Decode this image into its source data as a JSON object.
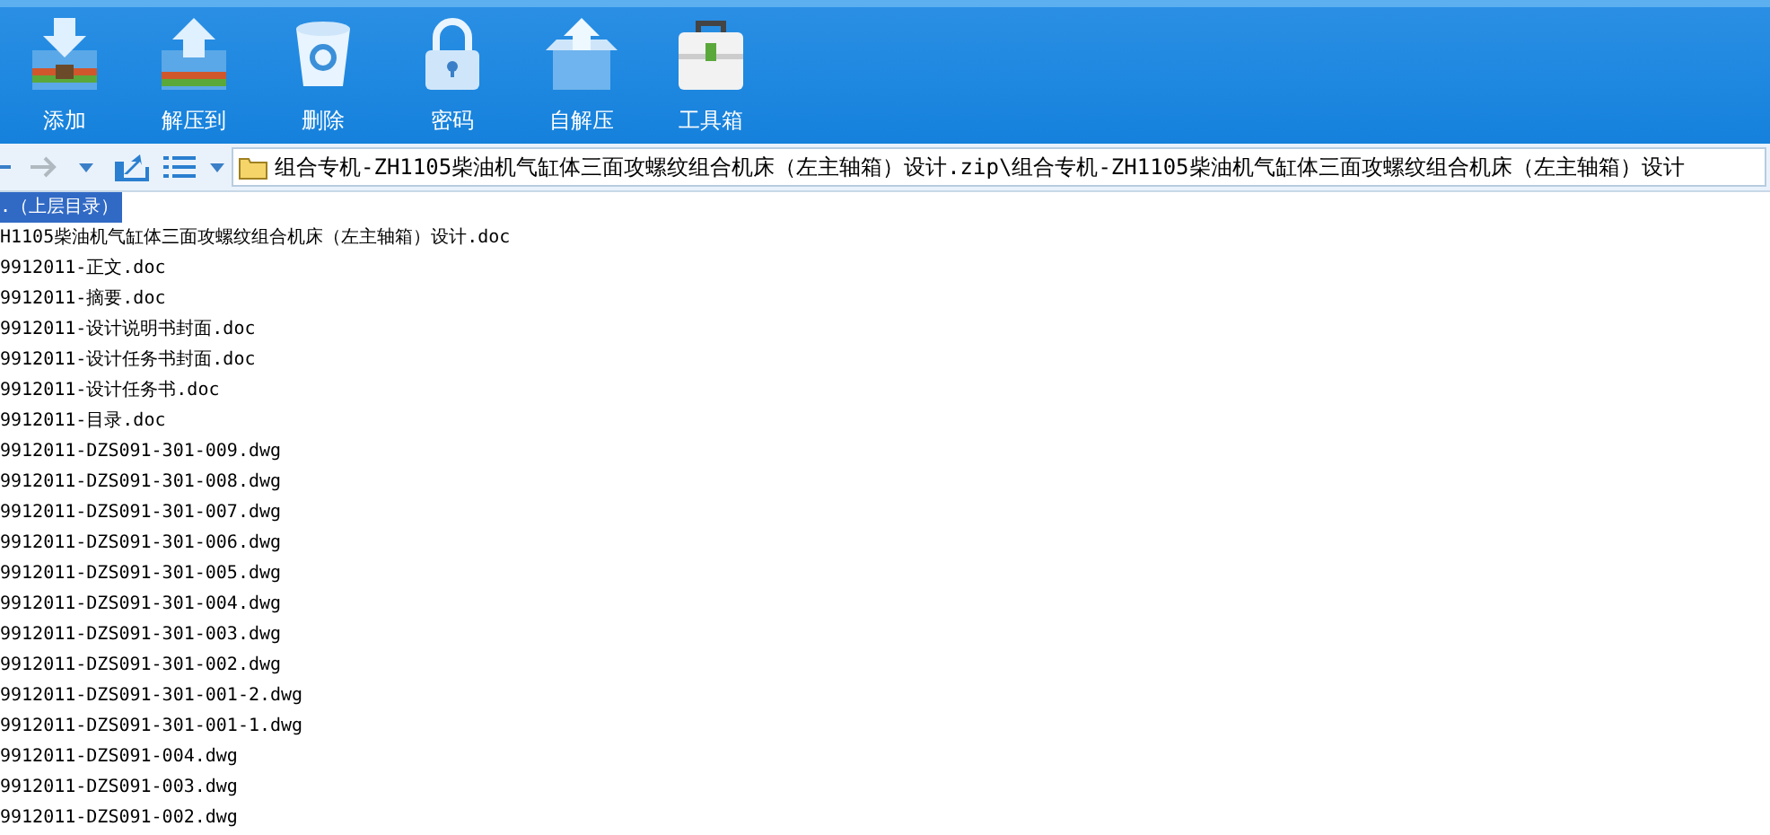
{
  "toolbar": {
    "buttons": [
      {
        "label": "添加"
      },
      {
        "label": "解压到"
      },
      {
        "label": "删除"
      },
      {
        "label": "密码"
      },
      {
        "label": "自解压"
      },
      {
        "label": "工具箱"
      }
    ]
  },
  "address_bar": {
    "value": "组合专机-ZH1105柴油机气缸体三面攻螺纹组合机床（左主轴箱）设计.zip\\组合专机-ZH1105柴油机气缸体三面攻螺纹组合机床（左主轴箱）设计"
  },
  "files": [
    {
      "name": ".（上层目录）",
      "selected": true
    },
    {
      "name": "H1105柴油机气缸体三面攻螺纹组合机床（左主轴箱）设计.doc",
      "selected": false
    },
    {
      "name": "9912011-正文.doc",
      "selected": false
    },
    {
      "name": "9912011-摘要.doc",
      "selected": false
    },
    {
      "name": "9912011-设计说明书封面.doc",
      "selected": false
    },
    {
      "name": "9912011-设计任务书封面.doc",
      "selected": false
    },
    {
      "name": "9912011-设计任务书.doc",
      "selected": false
    },
    {
      "name": "9912011-目录.doc",
      "selected": false
    },
    {
      "name": "9912011-DZS091-301-009.dwg",
      "selected": false
    },
    {
      "name": "9912011-DZS091-301-008.dwg",
      "selected": false
    },
    {
      "name": "9912011-DZS091-301-007.dwg",
      "selected": false
    },
    {
      "name": "9912011-DZS091-301-006.dwg",
      "selected": false
    },
    {
      "name": "9912011-DZS091-301-005.dwg",
      "selected": false
    },
    {
      "name": "9912011-DZS091-301-004.dwg",
      "selected": false
    },
    {
      "name": "9912011-DZS091-301-003.dwg",
      "selected": false
    },
    {
      "name": "9912011-DZS091-301-002.dwg",
      "selected": false
    },
    {
      "name": "9912011-DZS091-301-001-2.dwg",
      "selected": false
    },
    {
      "name": "9912011-DZS091-301-001-1.dwg",
      "selected": false
    },
    {
      "name": "9912011-DZS091-004.dwg",
      "selected": false
    },
    {
      "name": "9912011-DZS091-003.dwg",
      "selected": false
    },
    {
      "name": "9912011-DZS091-002.dwg",
      "selected": false
    }
  ]
}
